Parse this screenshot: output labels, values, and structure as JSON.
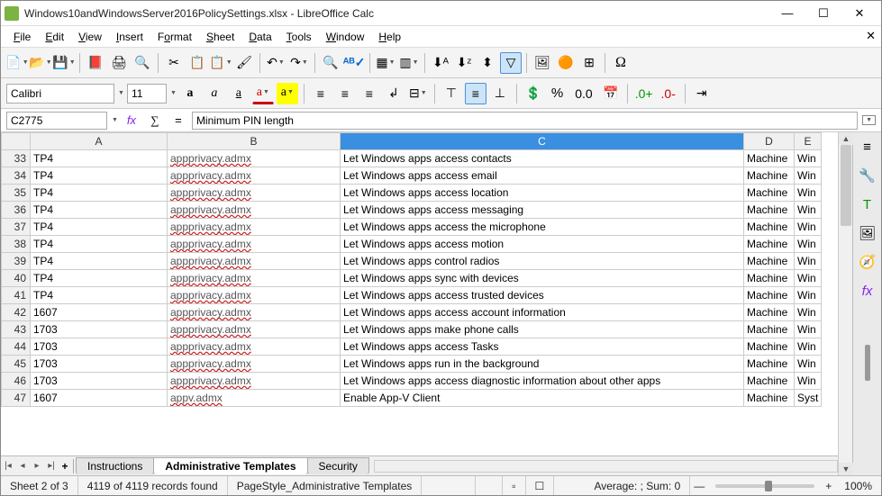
{
  "window": {
    "title": "Windows10andWindowsServer2016PolicySettings.xlsx - LibreOffice Calc"
  },
  "menus": [
    "File",
    "Edit",
    "View",
    "Insert",
    "Format",
    "Sheet",
    "Data",
    "Tools",
    "Window",
    "Help"
  ],
  "font": {
    "name": "Calibri",
    "size": "11"
  },
  "cell_ref": "C2775",
  "formula": "Minimum PIN length",
  "columns": [
    "A",
    "B",
    "C",
    "D",
    "E"
  ],
  "rows": [
    {
      "n": "33",
      "a": "TP4",
      "b": "appprivacy.admx",
      "c": "Let Windows apps access contacts",
      "d": "Machine",
      "e": "Win"
    },
    {
      "n": "34",
      "a": "TP4",
      "b": "appprivacy.admx",
      "c": "Let Windows apps access email",
      "d": "Machine",
      "e": "Win"
    },
    {
      "n": "35",
      "a": "TP4",
      "b": "appprivacy.admx",
      "c": "Let Windows apps access location",
      "d": "Machine",
      "e": "Win"
    },
    {
      "n": "36",
      "a": "TP4",
      "b": "appprivacy.admx",
      "c": "Let Windows apps access messaging",
      "d": "Machine",
      "e": "Win"
    },
    {
      "n": "37",
      "a": "TP4",
      "b": "appprivacy.admx",
      "c": "Let Windows apps access the microphone",
      "d": "Machine",
      "e": "Win"
    },
    {
      "n": "38",
      "a": "TP4",
      "b": "appprivacy.admx",
      "c": "Let Windows apps access motion",
      "d": "Machine",
      "e": "Win"
    },
    {
      "n": "39",
      "a": "TP4",
      "b": "appprivacy.admx",
      "c": "Let Windows apps control radios",
      "d": "Machine",
      "e": "Win"
    },
    {
      "n": "40",
      "a": "TP4",
      "b": "appprivacy.admx",
      "c": "Let Windows apps sync with devices",
      "d": "Machine",
      "e": "Win"
    },
    {
      "n": "41",
      "a": "TP4",
      "b": "appprivacy.admx",
      "c": "Let Windows apps access trusted devices",
      "d": "Machine",
      "e": "Win"
    },
    {
      "n": "42",
      "a": "1607",
      "b": "appprivacy.admx",
      "c": "Let Windows apps access account information",
      "d": "Machine",
      "e": "Win"
    },
    {
      "n": "43",
      "a": "1703",
      "b": "appprivacy.admx",
      "c": "Let Windows apps make phone calls",
      "d": "Machine",
      "e": "Win"
    },
    {
      "n": "44",
      "a": "1703",
      "b": "appprivacy.admx",
      "c": "Let Windows apps access Tasks",
      "d": "Machine",
      "e": "Win"
    },
    {
      "n": "45",
      "a": "1703",
      "b": "appprivacy.admx",
      "c": "Let Windows apps run in the background",
      "d": "Machine",
      "e": "Win"
    },
    {
      "n": "46",
      "a": "1703",
      "b": "appprivacy.admx",
      "c": "Let Windows apps access diagnostic information about other apps",
      "d": "Machine",
      "e": "Win"
    },
    {
      "n": "47",
      "a": "1607",
      "b": "appv.admx",
      "c": "Enable App-V Client",
      "d": "Machine",
      "e": "Syst"
    }
  ],
  "tabs": [
    "Instructions",
    "Administrative Templates",
    "Security"
  ],
  "active_tab": 1,
  "status": {
    "sheet": "Sheet 2 of 3",
    "records": "4119 of 4119 records found",
    "pagestyle": "PageStyle_Administrative Templates",
    "summary": "Average: ; Sum: 0",
    "zoom": "100%"
  },
  "percent": "%",
  "decimal_fmt": "0.0",
  "toolbar_dash": "—"
}
